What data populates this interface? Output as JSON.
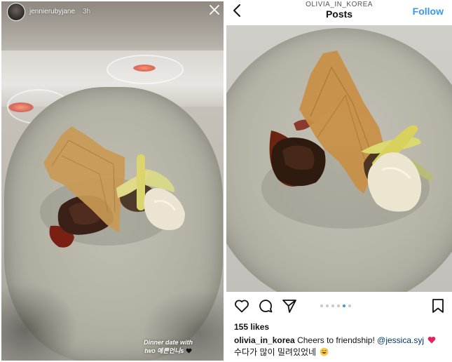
{
  "story": {
    "username": "jennierubyjane",
    "time": "3h",
    "caption_line1": "Dinner date with",
    "caption_line2": "two 예쁜언니s",
    "caption_emoji": "black-heart-emoji"
  },
  "post": {
    "account": "OLIVIA_IN_KOREA",
    "title": "Posts",
    "follow_label": "Follow",
    "likes": "155 likes",
    "caption_user": "olivia_in_korea",
    "caption_text": "Cheers to friendship!",
    "caption_mention": "@jessica.syj",
    "caption_emoji_1": "red-heart-emoji",
    "caption_line2": "수다가 많이 밀려있었네",
    "caption_emoji_2": "grinning-sweat-emoji",
    "carousel": {
      "count": 6,
      "active_index": 4
    },
    "colors": {
      "follow": "#3897f0",
      "active_dot": "#3897f0"
    }
  },
  "icons": [
    "close-icon",
    "back-chevron-icon",
    "heart-icon",
    "comment-icon",
    "share-icon",
    "bookmark-icon"
  ]
}
